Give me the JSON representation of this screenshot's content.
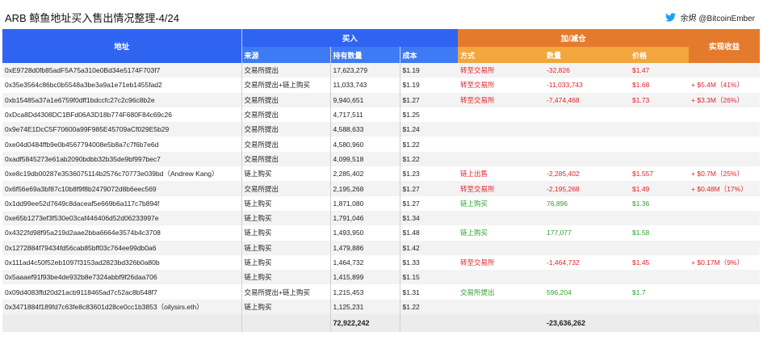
{
  "title": "ARB 鲸鱼地址买入售出情况整理-4/24",
  "credit": "余烬 @BitcoinEmber",
  "headers": {
    "address": "地址",
    "buy": "买入",
    "change": "加/减仓",
    "profit": "实现收益",
    "source": "来源",
    "holdings": "持有数量",
    "cost": "成本",
    "method": "方式",
    "quantity": "数量",
    "price": "价格"
  },
  "rows": [
    {
      "address": "0xE9728d0fb85adF5A75a310e0Bd34e5174F703f7",
      "source": "交易所提出",
      "holdings": "17,623,279",
      "cost": "$1.19",
      "method": "转至交易所",
      "qty": "-32,826",
      "price": "$1.47",
      "profit": "",
      "tone": "red"
    },
    {
      "address": "0x35e3564c86bc0b5548a3be3a9a1e71eb1455fad2",
      "source": "交易所提出+链上购买",
      "holdings": "11,033,743",
      "cost": "$1.19",
      "method": "转至交易所",
      "qty": "-11,033,743",
      "price": "$1.68",
      "profit": "+ $5.4M（41%）",
      "tone": "red"
    },
    {
      "address": "0xb15485a37a1e6759f0dff1bdccfc27c2c96c8b2e",
      "source": "交易所提出",
      "holdings": "9,940,651",
      "cost": "$1.27",
      "method": "转至交易所",
      "qty": "-7,474,468",
      "price": "$1.73",
      "profit": "+ $3.3M（26%）",
      "tone": "red"
    },
    {
      "address": "0xDca8Dd4308DC1BFd06A3D18b774F680F84c69c26",
      "source": "交易所提出",
      "holdings": "4,717,511",
      "cost": "$1.25",
      "method": "",
      "qty": "",
      "price": "",
      "profit": "",
      "tone": ""
    },
    {
      "address": "0x9e74E1DcC5F70600a99F985E45709aCf029E5b29",
      "source": "交易所提出",
      "holdings": "4,588,633",
      "cost": "$1.24",
      "method": "",
      "qty": "",
      "price": "",
      "profit": "",
      "tone": ""
    },
    {
      "address": "0xe04d0484ffb9e0b4567794008e5b8a7c7f6b7e6d",
      "source": "交易所提出",
      "holdings": "4,580,960",
      "cost": "$1.22",
      "method": "",
      "qty": "",
      "price": "",
      "profit": "",
      "tone": ""
    },
    {
      "address": "0xadf5845273e61ab2090bdbb32b35de9bf997bec7",
      "source": "交易所提出",
      "holdings": "4,099,518",
      "cost": "$1.22",
      "method": "",
      "qty": "",
      "price": "",
      "profit": "",
      "tone": ""
    },
    {
      "address": "0xe8c19db00287e3536075114b2576c70773e039bd（Andrew Kang）",
      "source": "链上购买",
      "holdings": "2,285,402",
      "cost": "$1.23",
      "method": "链上出售",
      "qty": "-2,285,402",
      "price": "$1.557",
      "profit": "+ $0.7M（25%）",
      "tone": "red"
    },
    {
      "address": "0x6f56e69a3bf87c10b8f9f8b2479072d8b6eec569",
      "source": "交易所提出",
      "holdings": "2,195,268",
      "cost": "$1.27",
      "method": "转至交易所",
      "qty": "-2,195,268",
      "price": "$1.49",
      "profit": "+ $0.48M（17%）",
      "tone": "red"
    },
    {
      "address": "0x1dd99ee52d7649c8daceaf5e669b6a117c7b894f",
      "source": "链上购买",
      "holdings": "1,871,080",
      "cost": "$1.27",
      "method": "链上购买",
      "qty": "76,896",
      "price": "$1.36",
      "profit": "",
      "tone": "green"
    },
    {
      "address": "0xe65b1273ef3f530e03caf446406d52d06233997e",
      "source": "链上购买",
      "holdings": "1,791,046",
      "cost": "$1.34",
      "method": "",
      "qty": "",
      "price": "",
      "profit": "",
      "tone": ""
    },
    {
      "address": "0x4322fd98f95a219d2aae2bba6664e3574b4c3708",
      "source": "链上购买",
      "holdings": "1,493,950",
      "cost": "$1.48",
      "method": "链上购买",
      "qty": "177,077",
      "price": "$1.58",
      "profit": "",
      "tone": "green"
    },
    {
      "address": "0x1272884f79434fd56cab85bff03c764ee99db0a6",
      "source": "链上购买",
      "holdings": "1,479,886",
      "cost": "$1.42",
      "method": "",
      "qty": "",
      "price": "",
      "profit": "",
      "tone": ""
    },
    {
      "address": "0x111ad4c50f52eb1097f3153ad2823bd326b0a80b",
      "source": "链上购买",
      "holdings": "1,464,732",
      "cost": "$1.33",
      "method": "转至交易所",
      "qty": "-1,464,732",
      "price": "$1.45",
      "profit": "+ $0.17M（9%）",
      "tone": "red"
    },
    {
      "address": "0x5aaaef91f93be4de932b8e7324abbf9f26daa706",
      "source": "链上购买",
      "holdings": "1,415,899",
      "cost": "$1.15",
      "method": "",
      "qty": "",
      "price": "",
      "profit": "",
      "tone": ""
    },
    {
      "address": "0x09d4083ffd20d21acb9118465ad7c52ac8b548f7",
      "source": "交易所提出+链上购买",
      "holdings": "1,215,453",
      "cost": "$1.31",
      "method": "交易所提出",
      "qty": "596,204",
      "price": "$1.7",
      "profit": "",
      "tone": "green"
    },
    {
      "address": "0x3471884f189fd7c63fe8c83601d28ce0cc1b3853（oilysirs.eth）",
      "source": "链上购买",
      "holdings": "1,125,231",
      "cost": "$1.22",
      "method": "",
      "qty": "",
      "price": "",
      "profit": "",
      "tone": ""
    }
  ],
  "totals": {
    "holdings": "72,922,242",
    "qty": "-23,636,262"
  },
  "colors": {
    "buy_header": "#2f64f2",
    "buy_subheader": "#3f7af5",
    "change_header": "#e47b2c",
    "change_subheader": "#f2a63b",
    "reduce_text": "#e0242b",
    "add_text": "#33a12f"
  }
}
